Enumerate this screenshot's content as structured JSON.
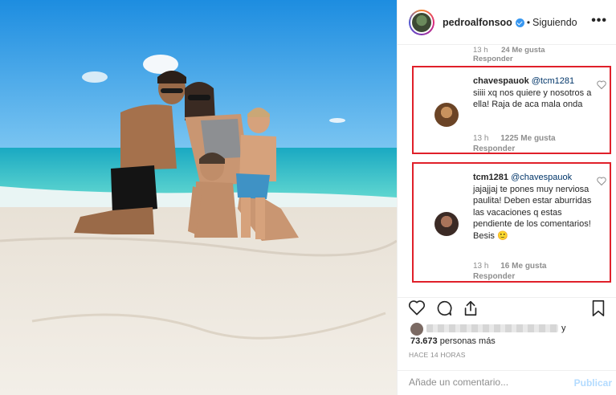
{
  "header": {
    "username": "pedroalfonsoo",
    "separator": "•",
    "following_label": "Siguiendo",
    "more_label": "•••"
  },
  "previous_comment": {
    "time": "13 h",
    "likes": "24 Me gusta",
    "reply_label": "Responder"
  },
  "comments": [
    {
      "user": "chavespauok",
      "mention": "@tcm1281",
      "text": "siiii xq nos quiere y nosotros a ella! Raja de aca mala onda",
      "time": "13 h",
      "likes": "1225 Me gusta",
      "reply_label": "Responder"
    },
    {
      "user": "tcm1281",
      "mention": "@chavespauok",
      "text": "jajajjaj te pones muy nerviosa paulita! Deben estar aburridas las vacaciones q estas pendiente de los comentarios! Besis 🙂",
      "time": "13 h",
      "likes": "16 Me gusta",
      "reply_label": "Responder"
    }
  ],
  "likes": {
    "conjunction": "y",
    "count": "73.673",
    "suffix": "personas más"
  },
  "post_age": "HACE 14 HORAS",
  "add_comment": {
    "placeholder": "Añade un comentario...",
    "publish_label": "Publicar"
  },
  "colors": {
    "highlight_border": "#e0202a",
    "verified_badge": "#3897f0",
    "publish_disabled": "#b3dbff"
  }
}
